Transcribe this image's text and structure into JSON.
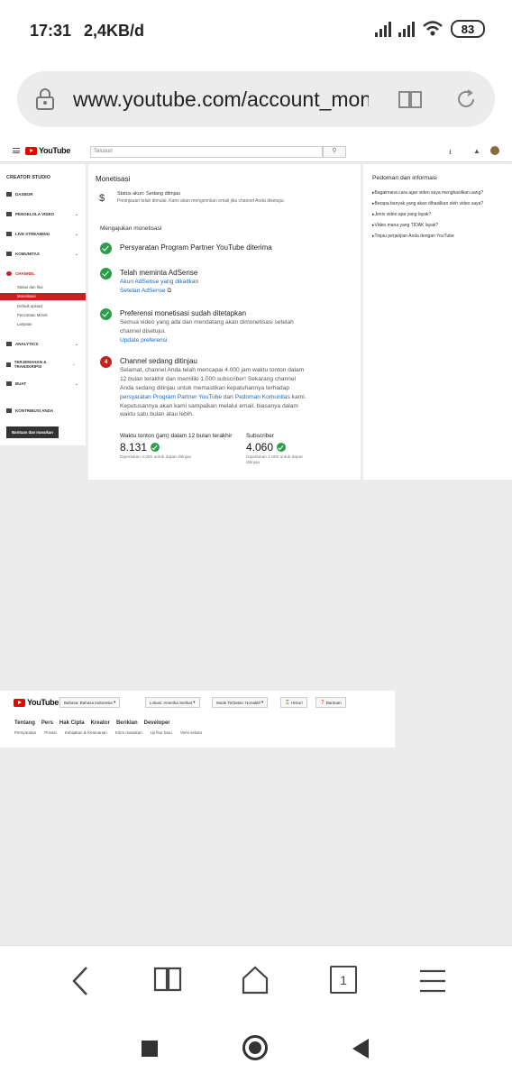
{
  "status_bar": {
    "time": "17:31",
    "speed": "2,4KB/d",
    "battery": "83"
  },
  "browser": {
    "url": "www.youtube.com/account_monetization",
    "tab_count": "1"
  },
  "header": {
    "logo_text": "YouTube",
    "search_placeholder": "Telusuri"
  },
  "sidebar": {
    "title": "CREATOR STUDIO",
    "items": [
      {
        "label": "DASBOR"
      },
      {
        "label": "PENGELOLA VIDEO"
      },
      {
        "label": "LIVE STREAMING"
      },
      {
        "label": "KOMUNITAS"
      },
      {
        "label": "CHANNEL"
      },
      {
        "label": "ANALYTICS"
      },
      {
        "label": "TERJEMAHAN & TRANSKRIPSI"
      },
      {
        "label": "BUAT"
      },
      {
        "label": "KONTRIBUSI ANDA"
      }
    ],
    "channel_subitems": [
      "Status dan fitur",
      "Monetisasi",
      "Default upload",
      "Pencitraan Merek",
      "Lanjutan"
    ],
    "feedback_button": "Bantuan dan masukan"
  },
  "main": {
    "title": "Monetisasi",
    "status_line": "Status akun: Sedang ditinjau",
    "status_desc": "Peninjauan telah dimulai. Kami akan mengirimkan email jika channel Anda disetujui.",
    "section_title": "Mengajukan monetisasi",
    "steps": [
      {
        "title": "Persyaratan Program Partner YouTube diterima"
      },
      {
        "title": "Telah meminta AdSense",
        "link1": "Akun AdSense yang dikaitkan",
        "link2": "Setelan AdSense"
      },
      {
        "title": "Preferensi monetisasi sudah ditetapkan",
        "desc": "Semua video yang ada dan mendatang akan dimonetisasi setelah channel disetujui.",
        "link": "Update preferensi"
      },
      {
        "number": "4",
        "title": "Channel sedang ditinjau",
        "desc_a": "Selamat, channel Anda telah mencapai 4.000 jam waktu tonton dalam 12 bulan terakhir dan memiliki 1.000 subscriber! Sekarang channel Anda sedang ditinjau untuk memastikan kepatuhannya terhadap ",
        "link_a": "persyaratan Program Partner YouTube",
        "desc_b": " dan ",
        "link_b": "Pedoman Komunitas",
        "desc_c": " kami. Keputusannya akan kami sampaikan melalui email, biasanya dalam waktu satu bulan atau lebih."
      }
    ],
    "stats": [
      {
        "label": "Waktu tonton (jam) dalam 12 bulan terakhir",
        "value": "8.131",
        "note": "Diperlukan 4.000 untuk dapat ditinjau"
      },
      {
        "label": "Subscriber",
        "value": "4.060",
        "note": "Diperlukan 1.000 untuk dapat ditinjau"
      }
    ]
  },
  "side_panel": {
    "title": "Pedoman dan informasi",
    "items": [
      "Bagaimana cara agar video saya menghasilkan uang?",
      "Berapa banyak yang akan dihasilkan oleh video saya?",
      "Jenis video apa yang layak?",
      "Video mana yang TIDAK layak?",
      "Tinjau perjanjian Anda dengan YouTube"
    ]
  },
  "footer": {
    "language": "Bahasa: Bahasa Indonesia",
    "location": "Lokasi: Amerika Serikat",
    "restricted": "Mode Terbatas: Nonaktif",
    "history": "Histori",
    "help": "Bantuan",
    "links_primary": [
      "Tentang",
      "Pers",
      "Hak Cipta",
      "Kreator",
      "Beriklan",
      "Developer"
    ],
    "links_secondary": [
      "Persyaratan",
      "Privasi",
      "Kebijakan & Keamanan",
      "Kirim masukan",
      "Uji fitur baru",
      "Versi seluler"
    ]
  }
}
